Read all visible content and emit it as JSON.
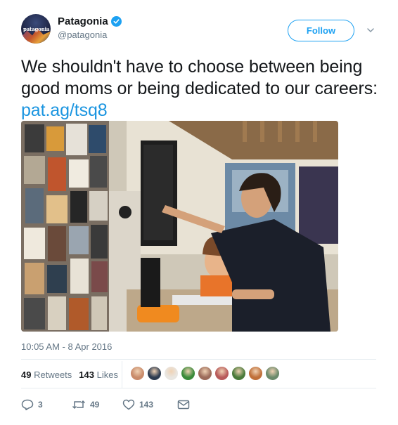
{
  "account": {
    "display_name": "Patagonia",
    "handle": "@patagonia",
    "avatar_logo_text": "patagonia",
    "verified": true
  },
  "follow_button": {
    "label": "Follow"
  },
  "tweet": {
    "text": "We shouldn't have to choose between being good moms or being dedicated to our careers: ",
    "link": "pat.ag/tsq8",
    "timestamp": "10:05 AM - 8 Apr 2016"
  },
  "stats": {
    "retweets_count": "49",
    "retweets_label": "Retweets",
    "likes_count": "143",
    "likes_label": "Likes"
  },
  "likers": [
    "#c98b6a",
    "#2d3b4f",
    "#e9e6e1",
    "#3a8a3a",
    "#9c6b5a",
    "#b85a5a",
    "#4a7a3a",
    "#c0703a",
    "#6b8a6b"
  ],
  "actions": {
    "reply_count": "3",
    "retweet_count": "49",
    "like_count": "143"
  },
  "colors": {
    "accent": "#1da1f2",
    "link": "#1b95e0",
    "muted": "#657786"
  },
  "icons": {
    "verified": "verified-badge-icon",
    "caret": "chevron-down-icon",
    "reply": "reply-icon",
    "retweet": "retweet-icon",
    "like": "heart-icon",
    "dm": "envelope-icon"
  }
}
